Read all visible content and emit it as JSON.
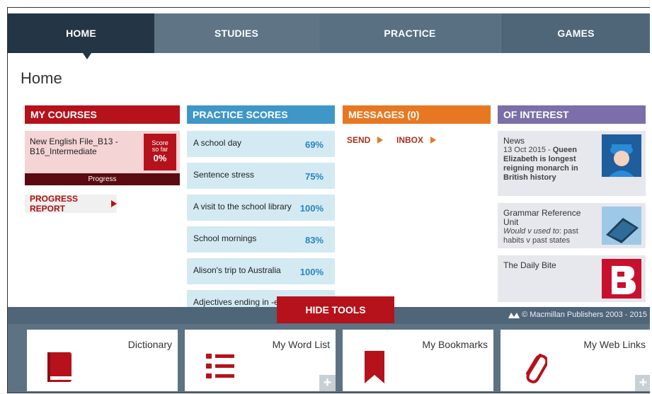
{
  "nav": {
    "tabs": [
      {
        "label": "HOME",
        "active": true
      },
      {
        "label": "STUDIES"
      },
      {
        "label": "PRACTICE"
      },
      {
        "label": "GAMES"
      }
    ]
  },
  "page_title": "Home",
  "courses": {
    "header": "MY COURSES",
    "course_name": "New English File_B13 - B16_Intermediate",
    "score_label_1": "Score",
    "score_label_2": "so far",
    "score_value": "0%",
    "progress_label": "Progress",
    "progress_report": "PROGRESS REPORT"
  },
  "scores": {
    "header": "PRACTICE SCORES",
    "items": [
      {
        "name": "A school day",
        "pct": "69%"
      },
      {
        "name": "Sentence stress",
        "pct": "75%"
      },
      {
        "name": "A visit to the school library",
        "pct": "100%"
      },
      {
        "name": "School mornings",
        "pct": "83%"
      },
      {
        "name": "Alison's trip to Australia",
        "pct": "100%"
      },
      {
        "name": "Adjectives ending in -ed",
        "pct": ""
      }
    ]
  },
  "messages": {
    "header": "MESSAGES (0)",
    "send": "SEND",
    "inbox": "INBOX"
  },
  "interest": {
    "header": "OF INTEREST",
    "news_title": "News",
    "news_date": "13 Oct 2015 - ",
    "news_headline": "Queen Elizabeth is longest reigning monarch in British history",
    "grammar_title": "Grammar Reference Unit",
    "grammar_italic": "Would v used to",
    "grammar_rest": ": past habits v past states",
    "bite_title": "The Daily Bite"
  },
  "tools": {
    "hide_label": "HIDE TOOLS",
    "copyright": "© Macmillan Publishers 2003 - 2015",
    "items": [
      {
        "label": "Dictionary",
        "icon": "book-icon"
      },
      {
        "label": "My Word List",
        "icon": "list-icon"
      },
      {
        "label": "My Bookmarks",
        "icon": "bookmark-icon"
      },
      {
        "label": "My Web Links",
        "icon": "paperclip-icon"
      }
    ],
    "plus": "+"
  },
  "colors": {
    "red": "#b5121b",
    "blue": "#3f97c7",
    "orange": "#e87722",
    "purple": "#7b6ea9",
    "nav": "#4f6678"
  }
}
